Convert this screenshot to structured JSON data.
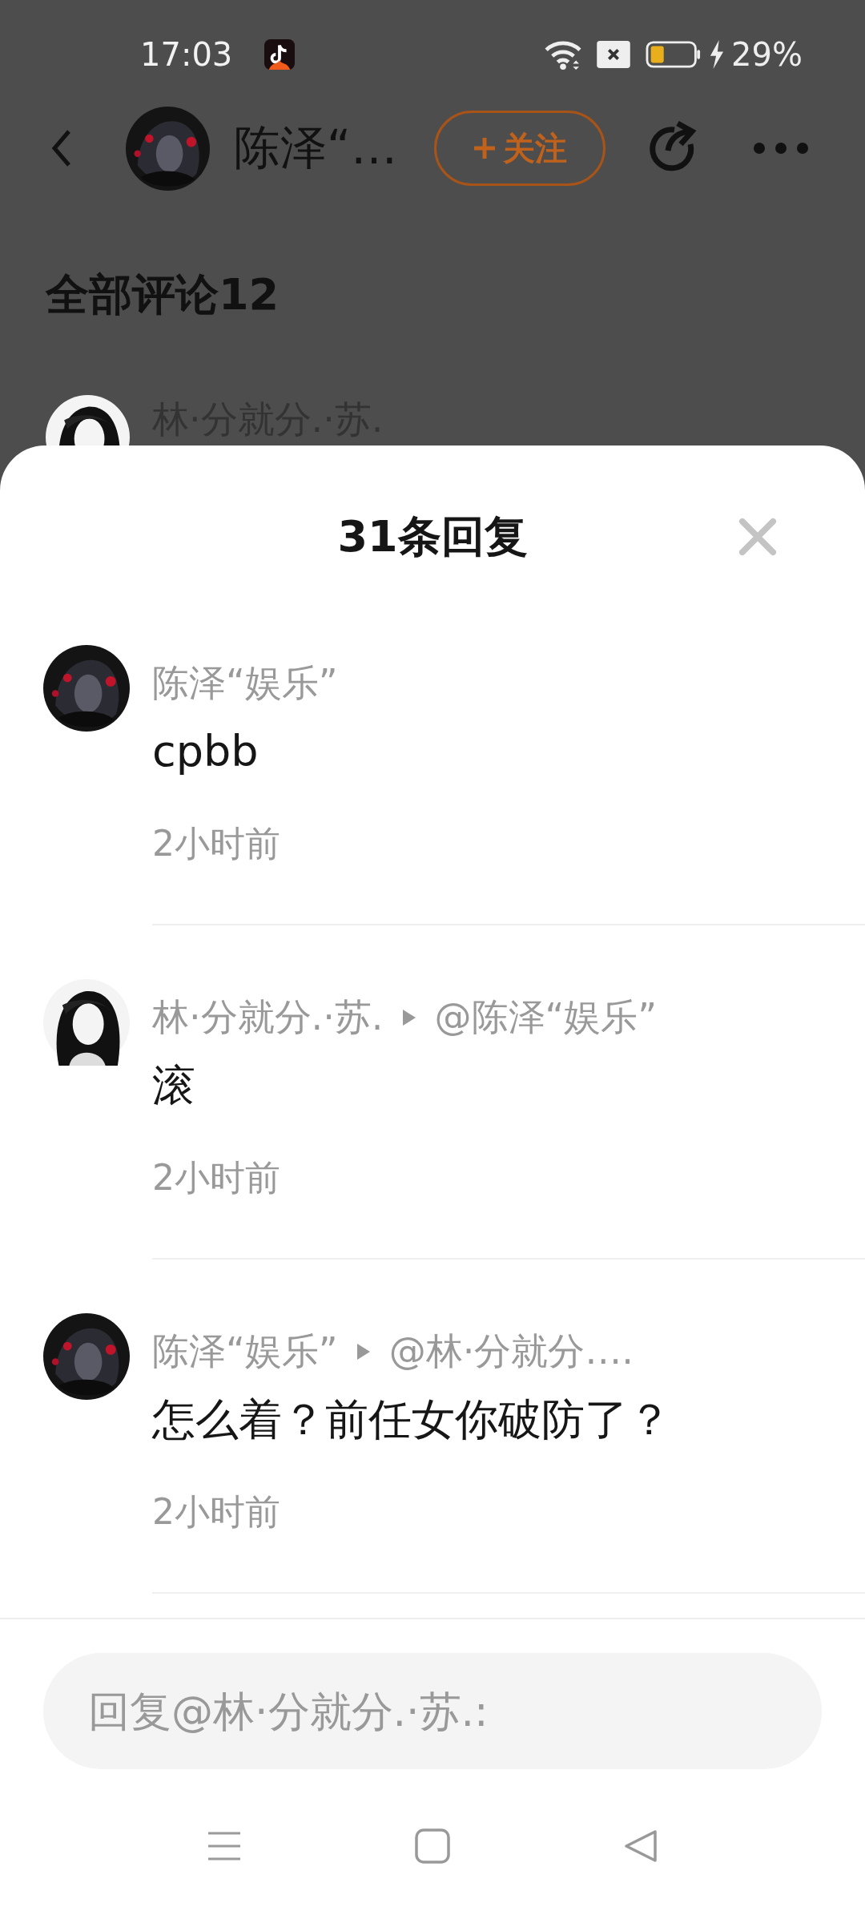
{
  "status_bar": {
    "time": "17:03",
    "battery": "29%"
  },
  "background_page": {
    "header": {
      "user_name": "陈泽“…",
      "follow_button": "关注"
    },
    "section_title": "全部评论12",
    "comment_preview": {
      "author": "林·分就分.·苏."
    }
  },
  "reply_sheet": {
    "title": "31条回复",
    "replies": [
      {
        "author": "陈泽“娱乐”",
        "text": "cpbb",
        "time": "2小时前"
      },
      {
        "author": "林·分就分.·苏.",
        "reply_to": "@陈泽“娱乐”",
        "text": "滚",
        "time": "2小时前"
      },
      {
        "author": "陈泽“娱乐”",
        "reply_to": "@林·分就分….",
        "text": "怎么着？前任女你破防了？",
        "time": "2小时前"
      }
    ],
    "reply_field": {
      "placeholder": "回复@林·分就分.·苏.:"
    }
  }
}
